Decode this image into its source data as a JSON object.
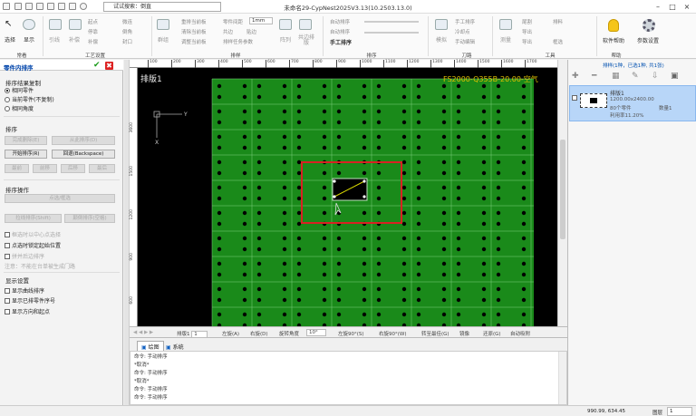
{
  "window": {
    "title": "未命名29-CypNest2025V3.13(10.2503.13.0)",
    "search_placeholder": "试试搜索：倒直"
  },
  "ribbon": {
    "big_buttons": [
      {
        "label": "选择"
      },
      {
        "label": "显示"
      },
      {
        "label": "引线"
      },
      {
        "label": "补偿"
      },
      {
        "label": "起刀"
      },
      {
        "label": "群组"
      },
      {
        "label": "阵列"
      },
      {
        "label": "共边排版"
      },
      {
        "label": "手工排序"
      },
      {
        "label": "模拟"
      },
      {
        "label": "测量"
      },
      {
        "label": "软件帮助"
      },
      {
        "label": "参数设置"
      }
    ],
    "small": [
      "起点",
      "停靠",
      "补偿",
      "封口",
      "微连",
      "倒角",
      "冷却点",
      "余料",
      "重排当前板",
      "清除当前板",
      "调整当前板",
      "零件间距",
      "1mm",
      "共边",
      "贴边",
      "排样任务参数",
      "自动排序",
      "手工排序",
      "工艺",
      "添加标签",
      "尾割",
      "导出",
      "导出",
      "排料",
      "框选",
      "文字",
      "余料",
      "工具",
      "预览",
      "手动编辑"
    ],
    "groups": [
      "常看",
      "工艺设置",
      "排样",
      "排序",
      "刀路",
      "工具",
      "帮助"
    ]
  },
  "left_panel": {
    "title": "零件内排序",
    "copy_section": "排序结果复制",
    "copy_options": [
      "相同零件",
      "当前零件(不复制)",
      "相同角度"
    ],
    "sort_section": "排序",
    "sort_buttons": [
      "完成删除(E)",
      "从此排序(D)",
      "开始排序(R)",
      "回退(Backspace)",
      "最前",
      "前移",
      "后移",
      "最后"
    ],
    "op_section": "排序操作",
    "op_buttons": [
      "点选/框选",
      "拉线排序(Shift)",
      "颠倒排序(空格)"
    ],
    "op_checks": [
      "框选时以中心点选择",
      "点选时锁定起始位置",
      "拼并后边排序"
    ],
    "op_note": "注意：不能在台单被生成门路",
    "display_section": "显示设置",
    "display_checks": [
      "显示曲线排序",
      "显示已排零件序号",
      "显示方向和起点"
    ]
  },
  "canvas": {
    "sheet_label": "排版1",
    "material_label": "FS2000-Q355B-20.00-空气",
    "axis_x": "Y",
    "axis_y": "X",
    "ruler_top": [
      "100",
      "200",
      "300",
      "400",
      "500",
      "600",
      "700",
      "800",
      "900",
      "1000",
      "1100",
      "1200",
      "1300",
      "1400",
      "1500",
      "1600",
      "1700"
    ],
    "ruler_left": [
      "3600",
      "1500",
      "1200",
      "900",
      "600"
    ]
  },
  "canvas_toolbar": {
    "sheet_select": "排版1",
    "left_rotate": "左旋(A)",
    "right_rotate": "右旋(D)",
    "rotate_angle_label": "旋转角度",
    "rotate_angle": "10°",
    "left90": "左旋90°(S)",
    "right90": "右旋90°(W)",
    "flip": "转至最佳(G)",
    "mirror": "镜像",
    "reset": "还原(G)",
    "auto_adjust": "自动吸附"
  },
  "right_panel": {
    "header": "排样(1种，已选1种, 共1张)",
    "sheet_name": "排版1",
    "sheet_size": "1200.00x2400.00",
    "part_count": "80个零件",
    "quantity_label": "数量1",
    "utilization": "利用率11.20%"
  },
  "tabs": [
    {
      "label": "绘图"
    },
    {
      "label": "系统"
    }
  ],
  "console": {
    "lines": [
      "命令: 手动排序",
      "*取消*",
      "命令: 手动排序",
      "*取消*",
      "命令: 手动排序",
      "命令: 手动排序"
    ]
  },
  "status": {
    "coords": "990.99, 634.45",
    "layer_label": "图层",
    "layer_value": "1"
  }
}
